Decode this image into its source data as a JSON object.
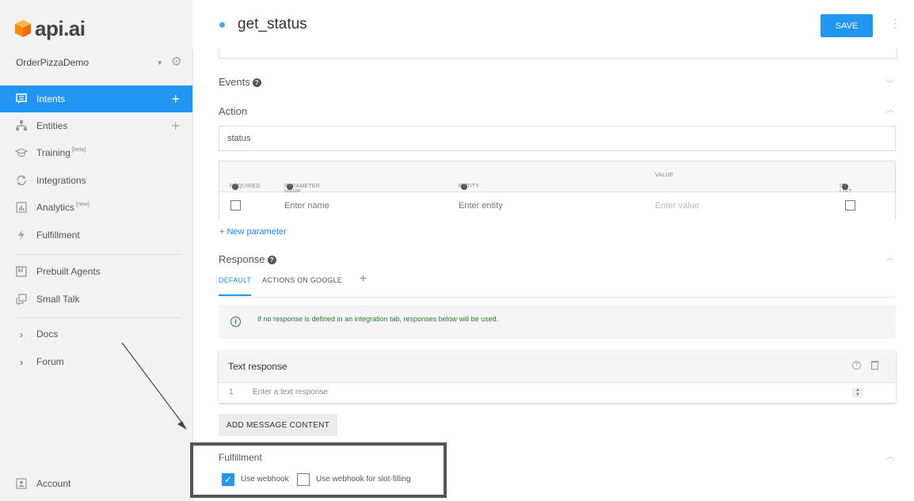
{
  "brand": {
    "logo_text": "api.ai",
    "logo_color": "#ff9800"
  },
  "agent": {
    "name": "OrderPizzaDemo"
  },
  "sidebar": {
    "items": [
      {
        "label": "Intents",
        "sup": "",
        "icon": "chat-icon",
        "active": true
      },
      {
        "label": "Entities",
        "sup": "",
        "icon": "hierarchy-icon"
      },
      {
        "label": "Training",
        "sup": "[beta]",
        "icon": "graduation-cap-icon"
      },
      {
        "label": "Integrations",
        "sup": "",
        "icon": "sync-icon"
      },
      {
        "label": "Analytics",
        "sup": "[new]",
        "icon": "chart-icon"
      },
      {
        "label": "Fulfillment",
        "sup": "",
        "icon": "bolt-icon"
      },
      {
        "label": "Prebuilt Agents",
        "sup": "",
        "icon": "bookmark-icon"
      },
      {
        "label": "Small Talk",
        "sup": "",
        "icon": "speech-icon"
      },
      {
        "label": "Docs",
        "sup": "",
        "icon": "chevron-right-icon"
      },
      {
        "label": "Forum",
        "sup": "",
        "icon": "chevron-right-icon"
      }
    ],
    "account_label": "Account"
  },
  "header": {
    "intent_name": "get_status",
    "save_label": "SAVE"
  },
  "events": {
    "title": "Events"
  },
  "action": {
    "title": "Action",
    "value": "status"
  },
  "params": {
    "headers": {
      "required": "REQUIRED",
      "name": "PARAMETER NAME",
      "entity": "ENTITY",
      "value": "VALUE",
      "is_list": "IS LIST"
    },
    "row": {
      "name_placeholder": "Enter name",
      "entity_placeholder": "Enter entity",
      "value_placeholder": "Enter value"
    },
    "new_param": "+ New parameter"
  },
  "response": {
    "title": "Response",
    "tabs": [
      "DEFAULT",
      "ACTIONS ON GOOGLE"
    ],
    "info": "If no response is defined in an integration tab, responses below will be used.",
    "card_title": "Text response",
    "row_number": "1",
    "row_placeholder": "Enter a text response",
    "add_content": "ADD MESSAGE CONTENT"
  },
  "fulfillment": {
    "title": "Fulfillment",
    "use_webhook": "Use webhook",
    "use_webhook_checked": true,
    "slot_filling": "Use webhook for slot-filling",
    "slot_filling_checked": false
  },
  "colors": {
    "accent": "#2196f3",
    "info_green": "#2e7d32"
  }
}
